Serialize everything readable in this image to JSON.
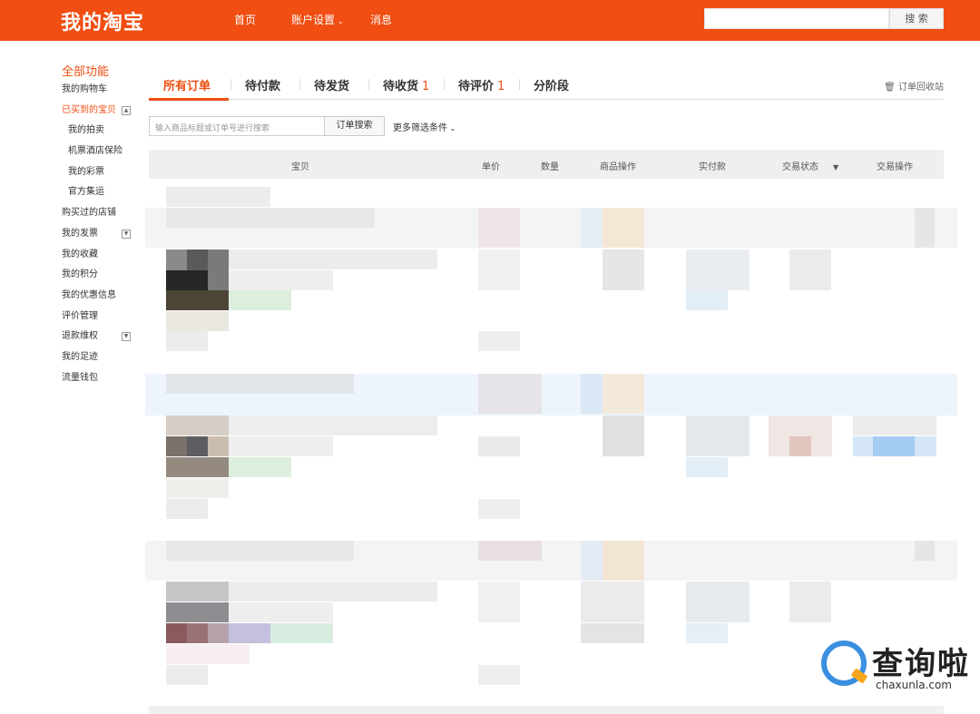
{
  "header": {
    "logo": "我的淘宝",
    "nav": [
      {
        "label": "首页"
      },
      {
        "label": "账户设置"
      },
      {
        "label": "消息"
      }
    ],
    "search_button": "搜 索"
  },
  "sidebar": {
    "title": "全部功能",
    "items": [
      {
        "label": "我的购物车"
      },
      {
        "label": "已买到的宝贝"
      },
      {
        "label": "我的拍卖"
      },
      {
        "label": "机票酒店保险"
      },
      {
        "label": "我的彩票"
      },
      {
        "label": "官方集运"
      },
      {
        "label": "购买过的店铺"
      },
      {
        "label": "我的发票"
      },
      {
        "label": "我的收藏"
      },
      {
        "label": "我的积分"
      },
      {
        "label": "我的优惠信息"
      },
      {
        "label": "评价管理"
      },
      {
        "label": "退款维权"
      },
      {
        "label": "我的足迹"
      },
      {
        "label": "流量钱包"
      }
    ]
  },
  "tabs": [
    {
      "label": "所有订单",
      "count": ""
    },
    {
      "label": "待付款",
      "count": ""
    },
    {
      "label": "待发货",
      "count": ""
    },
    {
      "label": "待收货",
      "count": "1"
    },
    {
      "label": "待评价",
      "count": "1"
    },
    {
      "label": "分阶段",
      "count": ""
    }
  ],
  "recycle_label": "订单回收站",
  "order_search": {
    "placeholder": "输入商品标题或订单号进行搜索",
    "button": "订单搜索",
    "more_filters": "更多筛选条件"
  },
  "table_header": {
    "item": "宝贝",
    "unit_price": "单价",
    "quantity": "数量",
    "item_action": "商品操作",
    "paid": "实付款",
    "status": "交易状态",
    "trade_action": "交易操作"
  },
  "watermark": {
    "text": "查询啦",
    "url": "chaxunla.com"
  },
  "colors": {
    "brand": "#f04e12",
    "watermark_blue": "#3a8fe0",
    "watermark_orange": "#f7a51c"
  }
}
